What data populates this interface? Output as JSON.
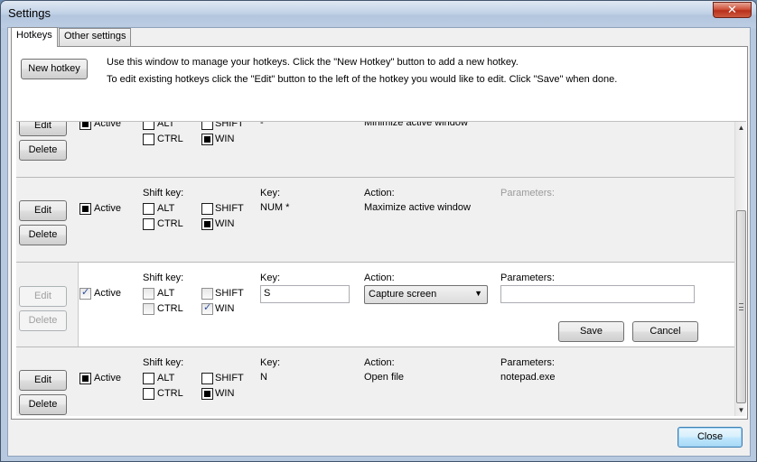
{
  "window": {
    "title": "Settings",
    "close_glyph": "✕"
  },
  "tabs": [
    "Hotkeys",
    "Other settings"
  ],
  "toolbar": {
    "new_hotkey_label": "New hotkey",
    "intro_line1": "Use this window to manage your hotkeys. Click the \"New Hotkey\" button to add a new hotkey.",
    "intro_line2": "To edit existing hotkeys click the \"Edit\" button to the left of the hotkey you would like to edit. Click \"Save\" when done."
  },
  "labels": {
    "edit": "Edit",
    "delete": "Delete",
    "active": "Active",
    "shift_key": "Shift key:",
    "alt": "ALT",
    "shift": "SHIFT",
    "ctrl": "CTRL",
    "win": "WIN",
    "key": "Key:",
    "action": "Action:",
    "parameters": "Parameters:",
    "save": "Save",
    "cancel": "Cancel"
  },
  "hotkeys": [
    {
      "active": true,
      "alt": false,
      "shift": false,
      "ctrl": false,
      "win": true,
      "key": "-",
      "action": "Minimize active window",
      "parameters": ""
    },
    {
      "active": true,
      "alt": false,
      "shift": false,
      "ctrl": false,
      "win": true,
      "key": "NUM *",
      "action": "Maximize active window",
      "parameters": ""
    },
    {
      "active": true,
      "alt": false,
      "shift": false,
      "ctrl": false,
      "win": true,
      "key": "S",
      "action": "Capture screen",
      "parameters": "",
      "editing": true
    },
    {
      "active": true,
      "alt": false,
      "shift": false,
      "ctrl": false,
      "win": true,
      "key": "N",
      "action": "Open file",
      "parameters": "notepad.exe"
    }
  ],
  "footer": {
    "close_label": "Close"
  },
  "icons": {
    "dropdown": "▼",
    "scroll_up": "▲",
    "scroll_down": "▼"
  }
}
